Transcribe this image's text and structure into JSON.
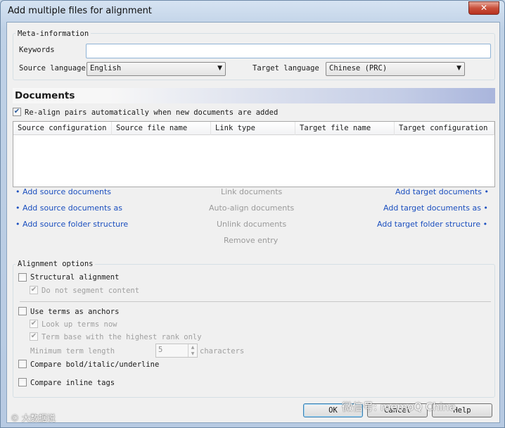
{
  "window": {
    "title": "Add multiple files for alignment",
    "close_glyph": "✕"
  },
  "meta": {
    "legend": "Meta-information",
    "keywords_label": "Keywords",
    "keywords_value": "",
    "source_language_label": "Source language",
    "source_language_value": "English",
    "target_language_label": "Target language",
    "target_language_value": "Chinese (PRC)"
  },
  "documents": {
    "header": "Documents",
    "realign": {
      "label": "Re-align pairs automatically when new documents are added",
      "checked": true
    },
    "columns": [
      "Source configuration",
      "Source file name",
      "Link type",
      "Target file name",
      "Target configuration"
    ],
    "left_links": [
      "• Add source documents",
      "• Add source documents as",
      "• Add source folder structure"
    ],
    "center_links": [
      "Link documents",
      "Auto-align documents",
      "Unlink documents",
      "Remove entry"
    ],
    "right_links": [
      "Add target documents •",
      "Add target documents as •",
      "Add target folder structure •"
    ]
  },
  "alignment": {
    "legend": "Alignment options",
    "structural": {
      "label": "Structural alignment",
      "checked": false
    },
    "no_segment": {
      "label": "Do not segment content",
      "checked": true,
      "enabled": false
    },
    "terms_anchors": {
      "label": "Use terms as anchors",
      "checked": false
    },
    "look_up": {
      "label": "Look up terms now",
      "checked": true,
      "enabled": false
    },
    "term_base": {
      "label": "Term base with the highest rank only",
      "checked": true,
      "enabled": false
    },
    "min_length_label": "Minimum term length",
    "min_length_value": "5",
    "characters": "characters",
    "compare_bold": {
      "label": "Compare bold/italic/underline",
      "checked": false
    },
    "compare_inline": {
      "label": "Compare inline tags",
      "checked": false
    }
  },
  "buttons": {
    "ok": "OK",
    "cancel": "Cancel",
    "help": "Help"
  },
  "watermarks": {
    "left": "© 大数据说",
    "right": "微信号: memoQ China"
  },
  "colors": {
    "link": "#1b4fbf",
    "disabled": "#a0a0a0",
    "header_gradient_end": "#a9b5dc"
  }
}
